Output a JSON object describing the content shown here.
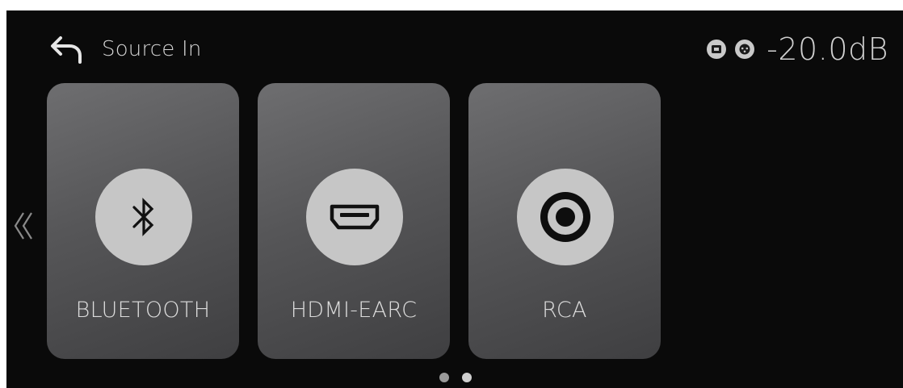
{
  "header": {
    "back_icon": "back-arrow-icon",
    "title": "Source In",
    "status_icons": [
      "display-icon",
      "xlr-connector-icon"
    ],
    "volume": "-20.0dB"
  },
  "navigation": {
    "prev_icon": "double-chevron-left-icon"
  },
  "sources": [
    {
      "label": "BLUETOOTH",
      "icon": "bluetooth-icon"
    },
    {
      "label": "HDMI-EARC",
      "icon": "hdmi-icon"
    },
    {
      "label": "RCA",
      "icon": "rca-icon"
    }
  ],
  "pagination": {
    "pages": 2,
    "current": 2
  },
  "colors": {
    "background": "#0a0a0a",
    "card_gradient_start": "#6e6e70",
    "card_gradient_end": "#3f3f41",
    "icon_badge": "#c6c6c6",
    "text": "#dcdcdc"
  }
}
